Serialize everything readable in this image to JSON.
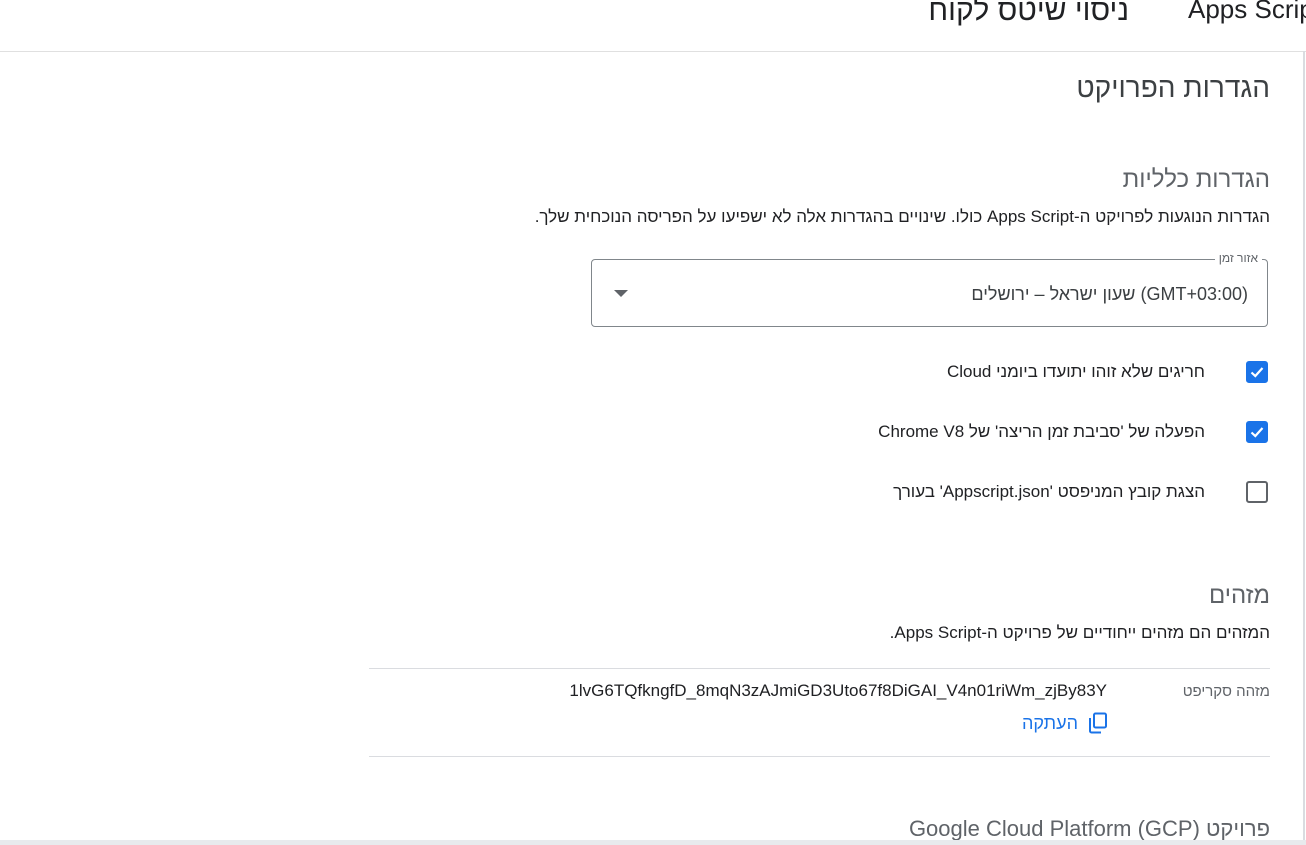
{
  "header": {
    "app_name": "Apps Script",
    "project_name": "ניסוי שיטס לקוח"
  },
  "page": {
    "title": "הגדרות הפרויקט"
  },
  "general": {
    "title": "הגדרות כלליות",
    "description": "הגדרות הנוגעות לפרויקט ה-Apps Script כולו. שינויים בהגדרות אלה לא ישפיעו על הפריסה הנוכחית שלך.",
    "timezone": {
      "label": "אזור זמן",
      "value": "(GMT+03:00) שעון ישראל – ירושלים"
    },
    "checkboxes": [
      {
        "label": "חריגים שלא זוהו יתועדו ביומני Cloud",
        "checked": true
      },
      {
        "label": "הפעלה של 'סביבת זמן הריצה' של Chrome V8",
        "checked": true
      },
      {
        "label": "הצגת קובץ המניפסט 'Appscript.json' בעורך",
        "checked": false
      }
    ]
  },
  "ids": {
    "title": "מזהים",
    "description": "המזהים הם מזהים ייחודיים של פרויקט ה-Apps Script.",
    "script_id_label": "מזהה סקריפט",
    "script_id_value": "1lvG6TQfkngfD_8mqN3zAJmiGD3Uto67f8DiGAI_V4n01riWm_zjBy83Y",
    "copy_label": "העתקה"
  },
  "gcp": {
    "title": "פרויקט Google Cloud Platform (GCP)"
  },
  "colors": {
    "accent": "#1a73e8",
    "divider": "#dadce0"
  }
}
